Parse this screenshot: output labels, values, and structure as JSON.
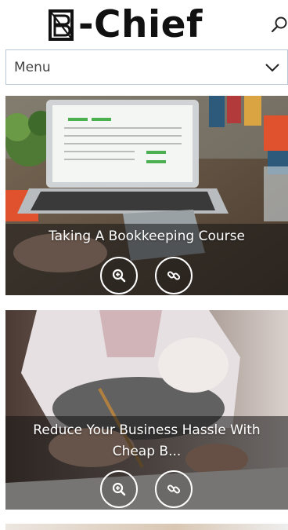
{
  "header": {
    "logo_text": "-Chief",
    "search_icon": "search-icon"
  },
  "menu": {
    "label": "Menu",
    "icon": "chevron-down-icon"
  },
  "posts": [
    {
      "title": "Taking A Bookkeeping Course",
      "zoom_icon": "zoom-in-icon",
      "link_icon": "link-icon"
    },
    {
      "title": "Reduce Your Business Hassle With Cheap B...",
      "zoom_icon": "zoom-in-icon",
      "link_icon": "link-icon"
    }
  ],
  "colors": {
    "menu_border": "#b9c8d6",
    "overlay": "#141414",
    "text_white": "#ffffff"
  }
}
